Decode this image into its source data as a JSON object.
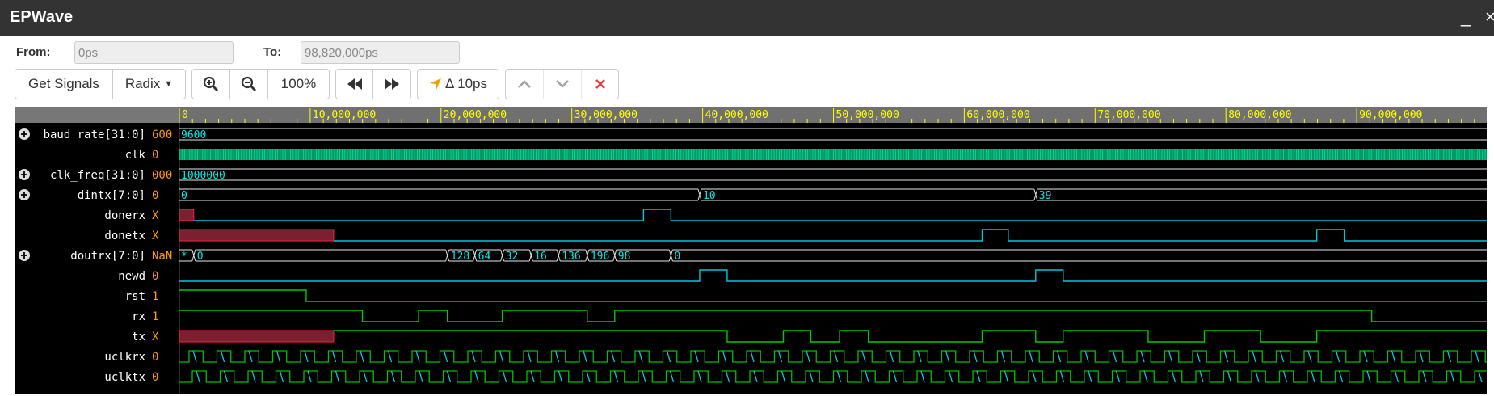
{
  "app": {
    "title": "EPWave",
    "minimize": "_",
    "close": "×"
  },
  "range": {
    "from_label": "From:",
    "from_value": "0ps",
    "to_label": "To:",
    "to_value": "98,820,000ps"
  },
  "toolbar": {
    "get_signals": "Get Signals",
    "radix": "Radix",
    "zoom_level": "100%",
    "delta": "Δ 10ps"
  },
  "timeline": {
    "ticks": [
      "0",
      "10,000,000",
      "20,000,000",
      "30,000,000",
      "40,000,000",
      "50,000,000",
      "60,000,000",
      "70,000,000",
      "80,000,000",
      "90,000,000"
    ]
  },
  "signals": [
    {
      "name": "baud_rate[31:0]",
      "value": "600",
      "bus": true
    },
    {
      "name": "clk",
      "value": "0",
      "bus": false
    },
    {
      "name": "clk_freq[31:0]",
      "value": "000",
      "bus": true
    },
    {
      "name": "dintx[7:0]",
      "value": "0",
      "bus": true
    },
    {
      "name": "donerx",
      "value": "X",
      "bus": false
    },
    {
      "name": "donetx",
      "value": "X",
      "bus": false
    },
    {
      "name": "doutrx[7:0]",
      "value": "NaN",
      "bus": true
    },
    {
      "name": "newd",
      "value": "0",
      "bus": false
    },
    {
      "name": "rst",
      "value": "1",
      "bus": false
    },
    {
      "name": "rx",
      "value": "1",
      "bus": false
    },
    {
      "name": "tx",
      "value": "X",
      "bus": false
    },
    {
      "name": "uclkrx",
      "value": "0",
      "bus": false
    },
    {
      "name": "uclktx",
      "value": "0",
      "bus": false
    }
  ],
  "bus_labels": {
    "baud_rate": [
      "9600"
    ],
    "clk_freq": [
      "1000000"
    ],
    "dintx": [
      "0",
      "10",
      "39"
    ],
    "doutrx": [
      "*",
      "0",
      "128",
      "64",
      "32",
      "16",
      "136",
      "196",
      "98",
      "0"
    ]
  },
  "colors": {
    "background": "#000000",
    "wave_green": "#00cc00",
    "wave_cyan": "#00c8d8",
    "bus_value": "#00e8e8",
    "signal_value": "#ff9900",
    "x_fill": "#7a2030",
    "x_border": "#ff2040",
    "ruler_text": "#ffff00",
    "clk_fill": "#009966"
  }
}
